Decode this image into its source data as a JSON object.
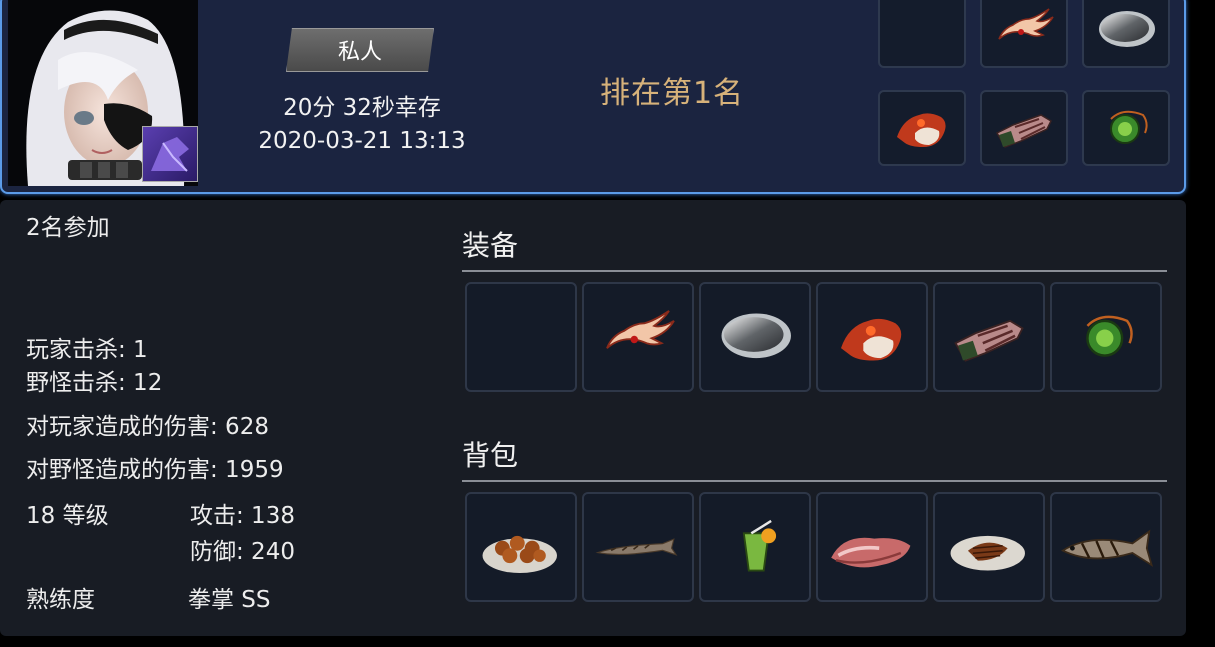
{
  "header": {
    "mode_label": "私人",
    "survival_time": "20分 32秒幸存",
    "datetime": "2020-03-21 13:13",
    "rank_text": "排在第1名"
  },
  "top_slots": [
    {
      "icon": "empty-slot"
    },
    {
      "icon": "wing-headband-icon"
    },
    {
      "icon": "silver-disc-icon"
    },
    {
      "icon": "red-armor-icon"
    },
    {
      "icon": "armored-boots-icon"
    },
    {
      "icon": "green-accessory-icon"
    }
  ],
  "stats": {
    "participants": "2名参加",
    "player_kills": "玩家击杀: 1",
    "monster_kills": "野怪击杀: 12",
    "damage_to_players": "对玩家造成的伤害: 628",
    "damage_to_monsters": "对野怪造成的伤害: 1959",
    "level": "18 等级",
    "attack": "攻击: 138",
    "defense": "防御: 240",
    "mastery_label": "熟练度",
    "mastery_value": "拳掌 SS"
  },
  "equipment": {
    "title": "装备",
    "items": [
      {
        "icon": "empty-slot"
      },
      {
        "icon": "wing-headband-icon"
      },
      {
        "icon": "silver-disc-icon"
      },
      {
        "icon": "red-armor-icon"
      },
      {
        "icon": "armored-boots-icon"
      },
      {
        "icon": "green-accessory-icon"
      }
    ]
  },
  "backpack": {
    "title": "背包",
    "items": [
      {
        "icon": "meatballs-plate-icon"
      },
      {
        "icon": "dried-fish-icon"
      },
      {
        "icon": "green-drink-icon"
      },
      {
        "icon": "raw-meat-icon"
      },
      {
        "icon": "sliced-meat-plate-icon"
      },
      {
        "icon": "grilled-fish-icon"
      }
    ]
  }
}
